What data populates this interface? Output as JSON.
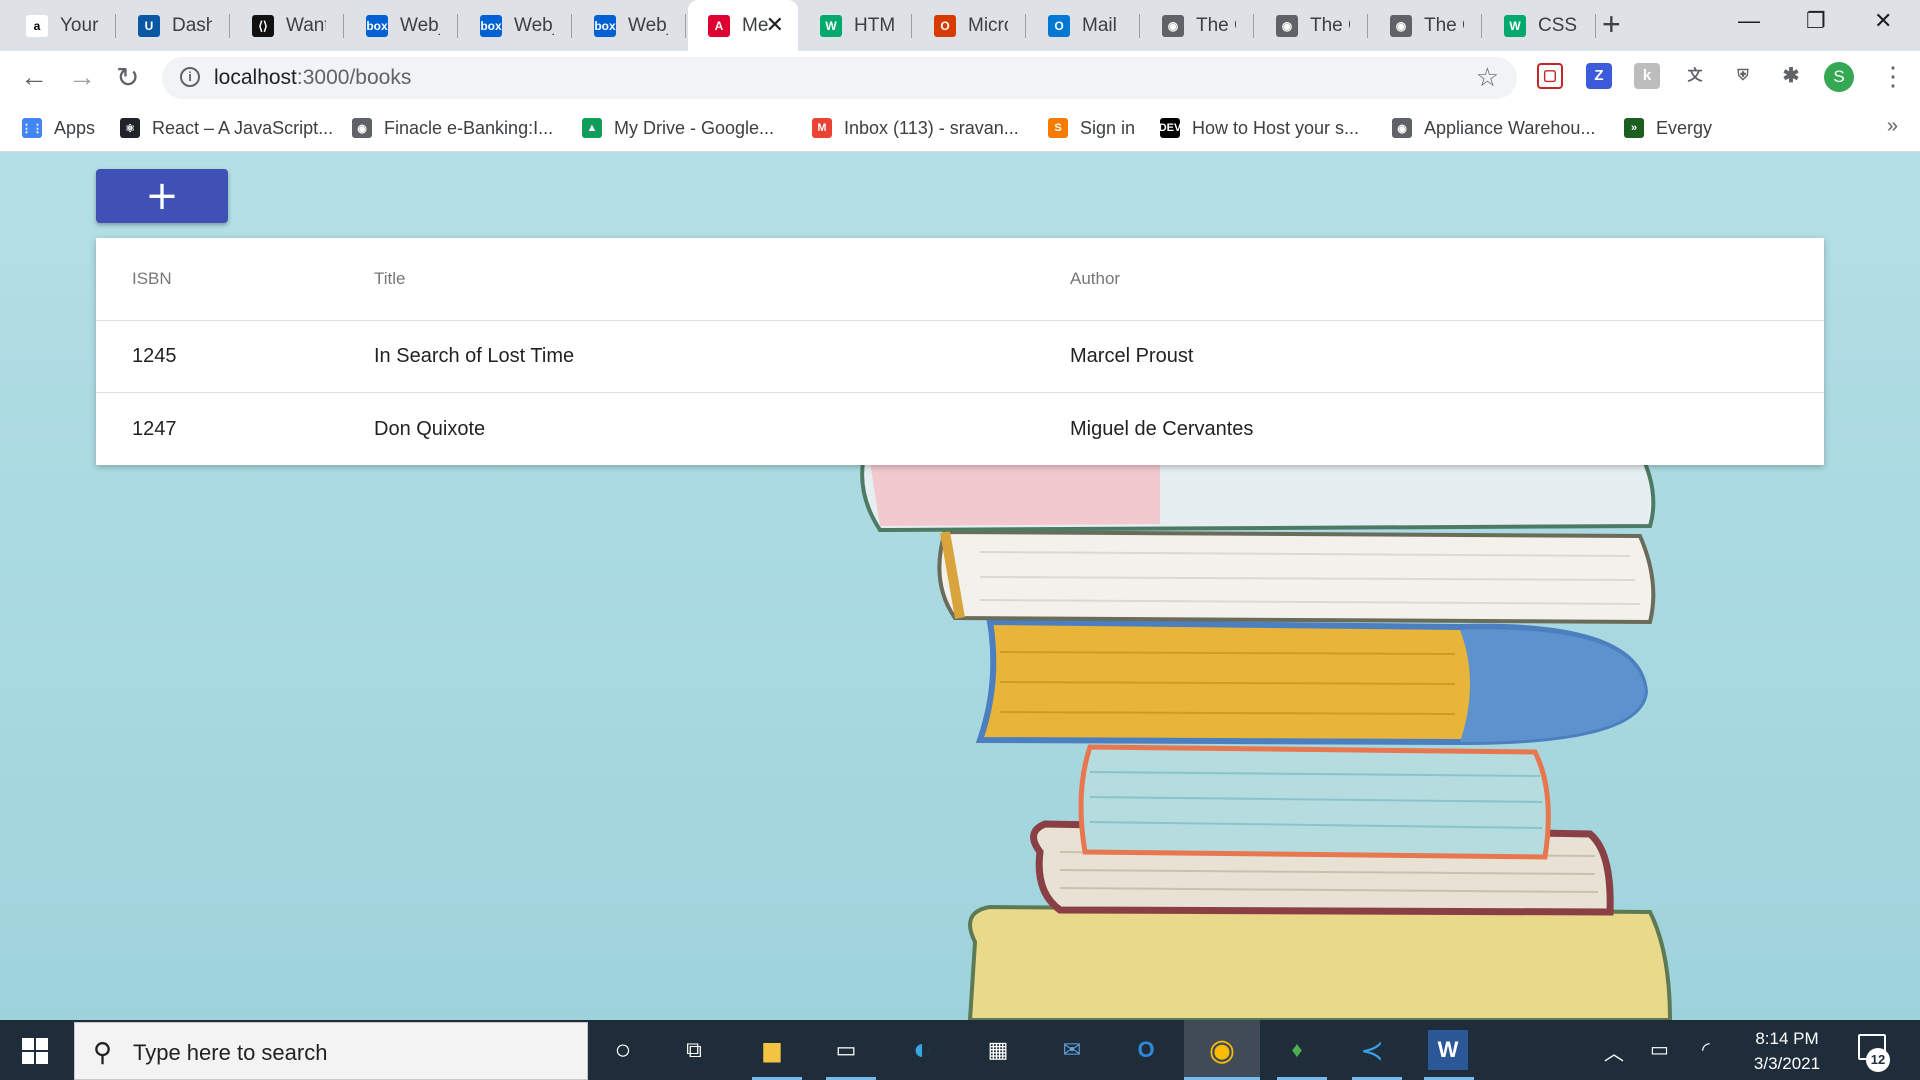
{
  "browser": {
    "tabs": [
      {
        "favicon": "amazon-icon",
        "title": "Your C",
        "fav_color": "#ffffff",
        "fav_text": "a"
      },
      {
        "favicon": "umkc-icon",
        "title": "Dashb",
        "fav_color": "#0a57a4",
        "fav_text": "U"
      },
      {
        "favicon": "code-icon",
        "title": "Want t",
        "fav_color": "#111111",
        "fav_text": "⟨⟩"
      },
      {
        "favicon": "box-icon",
        "title": "Web_L",
        "fav_color": "#0061d5",
        "fav_text": "box"
      },
      {
        "favicon": "box-icon",
        "title": "Web_L",
        "fav_color": "#0061d5",
        "fav_text": "box"
      },
      {
        "favicon": "box-icon",
        "title": "Web_L",
        "fav_color": "#0061d5",
        "fav_text": "box"
      },
      {
        "favicon": "angular-icon",
        "title": "Me",
        "fav_color": "#dd0031",
        "fav_text": "A",
        "active": true
      },
      {
        "favicon": "w3schools-icon",
        "title": "HTML",
        "fav_color": "#04aa6d",
        "fav_text": "W"
      },
      {
        "favicon": "office-icon",
        "title": "Micros",
        "fav_color": "#d83b01",
        "fav_text": "O"
      },
      {
        "favicon": "outlook-icon",
        "title": "Mail -",
        "fav_color": "#0078d4",
        "fav_text": "O"
      },
      {
        "favicon": "globe-icon",
        "title": "The Gr",
        "fav_color": "#5f6368",
        "fav_text": "◉"
      },
      {
        "favicon": "globe-icon",
        "title": "The Gr",
        "fav_color": "#5f6368",
        "fav_text": "◉"
      },
      {
        "favicon": "globe-icon",
        "title": "The Gr",
        "fav_color": "#5f6368",
        "fav_text": "◉"
      },
      {
        "favicon": "w3schools-icon",
        "title": "CSS b",
        "fav_color": "#04aa6d",
        "fav_text": "W"
      }
    ],
    "url_host": "localhost",
    "url_path": ":3000/books",
    "bookmarks": [
      {
        "icon": "apps-grid-icon",
        "label": "Apps",
        "color": "#4285f4",
        "text": "⋮⋮"
      },
      {
        "icon": "react-icon",
        "label": "React – A JavaScript...",
        "color": "#20232a",
        "text": "⚛"
      },
      {
        "icon": "globe-icon",
        "label": "Finacle e-Banking:I...",
        "color": "#5f6368",
        "text": "◉"
      },
      {
        "icon": "google-drive-icon",
        "label": "My Drive - Google...",
        "color": "#0f9d58",
        "text": "▲"
      },
      {
        "icon": "gmail-icon",
        "label": "Inbox (113) - sravan...",
        "color": "#ea4335",
        "text": "M"
      },
      {
        "icon": "signin-icon",
        "label": "Sign in",
        "color": "#f57c00",
        "text": "S"
      },
      {
        "icon": "dev-icon",
        "label": "How to Host your s...",
        "color": "#000000",
        "text": "DEV"
      },
      {
        "icon": "globe-icon",
        "label": "Appliance Warehou...",
        "color": "#5f6368",
        "text": "◉"
      },
      {
        "icon": "evergy-icon",
        "label": "Evergy",
        "color": "#1b5e20",
        "text": "»"
      }
    ]
  },
  "app": {
    "add_button": "+",
    "table": {
      "headers": [
        "ISBN",
        "Title",
        "Author"
      ],
      "rows": [
        [
          "1245",
          "In Search of Lost Time",
          "Marcel Proust"
        ],
        [
          "1247",
          "Don Quixote",
          "Miguel de Cervantes"
        ]
      ]
    }
  },
  "taskbar": {
    "search_placeholder": "Type here to search",
    "time": "8:14 PM",
    "date": "3/3/2021",
    "notifications": "12"
  },
  "colors": {
    "accent": "#3f51b5",
    "page_bg": "#b4dfe6",
    "taskbar_bg": "#1f2c3a"
  }
}
